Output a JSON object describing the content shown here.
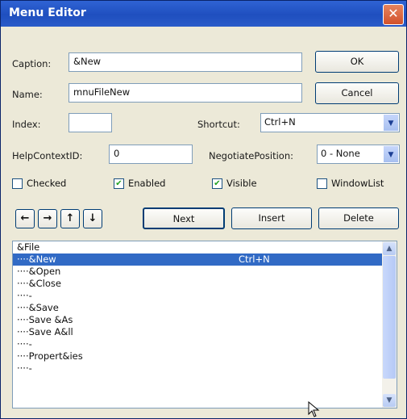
{
  "window": {
    "title": "Menu Editor"
  },
  "fields": {
    "caption_label": "Caption:",
    "caption_value": "&New",
    "name_label": "Name:",
    "name_value": "mnuFileNew",
    "index_label": "Index:",
    "index_value": "",
    "shortcut_label": "Shortcut:",
    "shortcut_value": "Ctrl+N",
    "helpcontext_label": "HelpContextID:",
    "helpcontext_value": "0",
    "negotiate_label": "NegotiatePosition:",
    "negotiate_value": "0 - None"
  },
  "buttons": {
    "ok": "OK",
    "cancel": "Cancel",
    "next": "Next",
    "insert": "Insert",
    "delete": "Delete",
    "left": "←",
    "right": "→",
    "up": "↑",
    "down": "↓"
  },
  "checks": {
    "checked": {
      "label": "Checked",
      "state": false
    },
    "enabled": {
      "label": "Enabled",
      "state": true
    },
    "visible": {
      "label": "Visible",
      "state": true
    },
    "windowlist": {
      "label": "WindowList",
      "state": false
    }
  },
  "menu_list": {
    "items": [
      {
        "text": "&File",
        "shortcut": "",
        "selected": false
      },
      {
        "text": "····&New",
        "shortcut": "Ctrl+N",
        "selected": true
      },
      {
        "text": "····&Open",
        "shortcut": "",
        "selected": false
      },
      {
        "text": "····&Close",
        "shortcut": "",
        "selected": false
      },
      {
        "text": "····-",
        "shortcut": "",
        "selected": false
      },
      {
        "text": "····&Save",
        "shortcut": "",
        "selected": false
      },
      {
        "text": "····Save &As",
        "shortcut": "",
        "selected": false
      },
      {
        "text": "····Save A&ll",
        "shortcut": "",
        "selected": false
      },
      {
        "text": "····-",
        "shortcut": "",
        "selected": false
      },
      {
        "text": "····Propert&ies",
        "shortcut": "",
        "selected": false
      },
      {
        "text": "····-",
        "shortcut": "",
        "selected": false
      }
    ]
  },
  "colors": {
    "titlebar": "#2f63d4",
    "selection": "#316ac5",
    "window_bg": "#ece9d8"
  }
}
